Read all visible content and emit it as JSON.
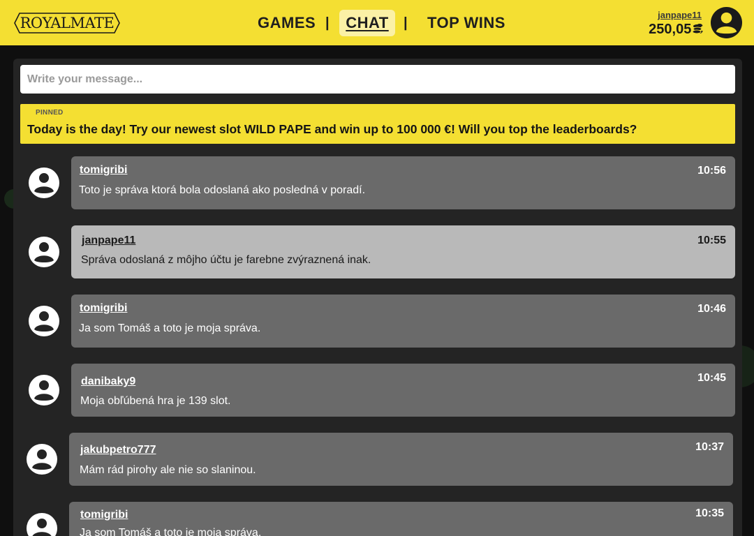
{
  "header": {
    "logo_text": "ROYALMATE",
    "nav": {
      "games": "GAMES",
      "separator": "|",
      "chat": "CHAT",
      "top_wins": "TOP WINS"
    },
    "user": {
      "username": "janpape11",
      "balance": "250,05 €"
    }
  },
  "chat": {
    "input_placeholder": "Write your message...",
    "pinned": {
      "label": "PINNED",
      "text": "Today is the day! Try our newest slot WILD PAPE and win up to 100 000 €! Will you top the leaderboards?"
    },
    "messages": [
      {
        "user": "tomigribi",
        "time": "10:56",
        "text": "Toto je správa ktorá bola odoslaná ako posledná v poradí."
      },
      {
        "user": "janpape11",
        "time": "10:55",
        "text": "Správa odoslaná z môjho účtu je farebne zvýraznená inak."
      },
      {
        "user": "tomigribi",
        "time": "10:46",
        "text": "Ja som Tomáš a toto je moja správa."
      },
      {
        "user": "danibaky9",
        "time": "10:45",
        "text": "Moja obľúbená hra je 139 slot."
      },
      {
        "user": "jakubpetro777",
        "time": "10:37",
        "text": "Mám rád pirohy ale nie so slaninou."
      },
      {
        "user": "tomigribi",
        "time": "10:35",
        "text": "Ja som Tomáš a toto je moja správa."
      }
    ]
  },
  "colors": {
    "accent_yellow": "#f4df32",
    "bubble_default": "#6a6a6a",
    "bubble_own": "#b9b9b9",
    "panel": "#242424"
  }
}
